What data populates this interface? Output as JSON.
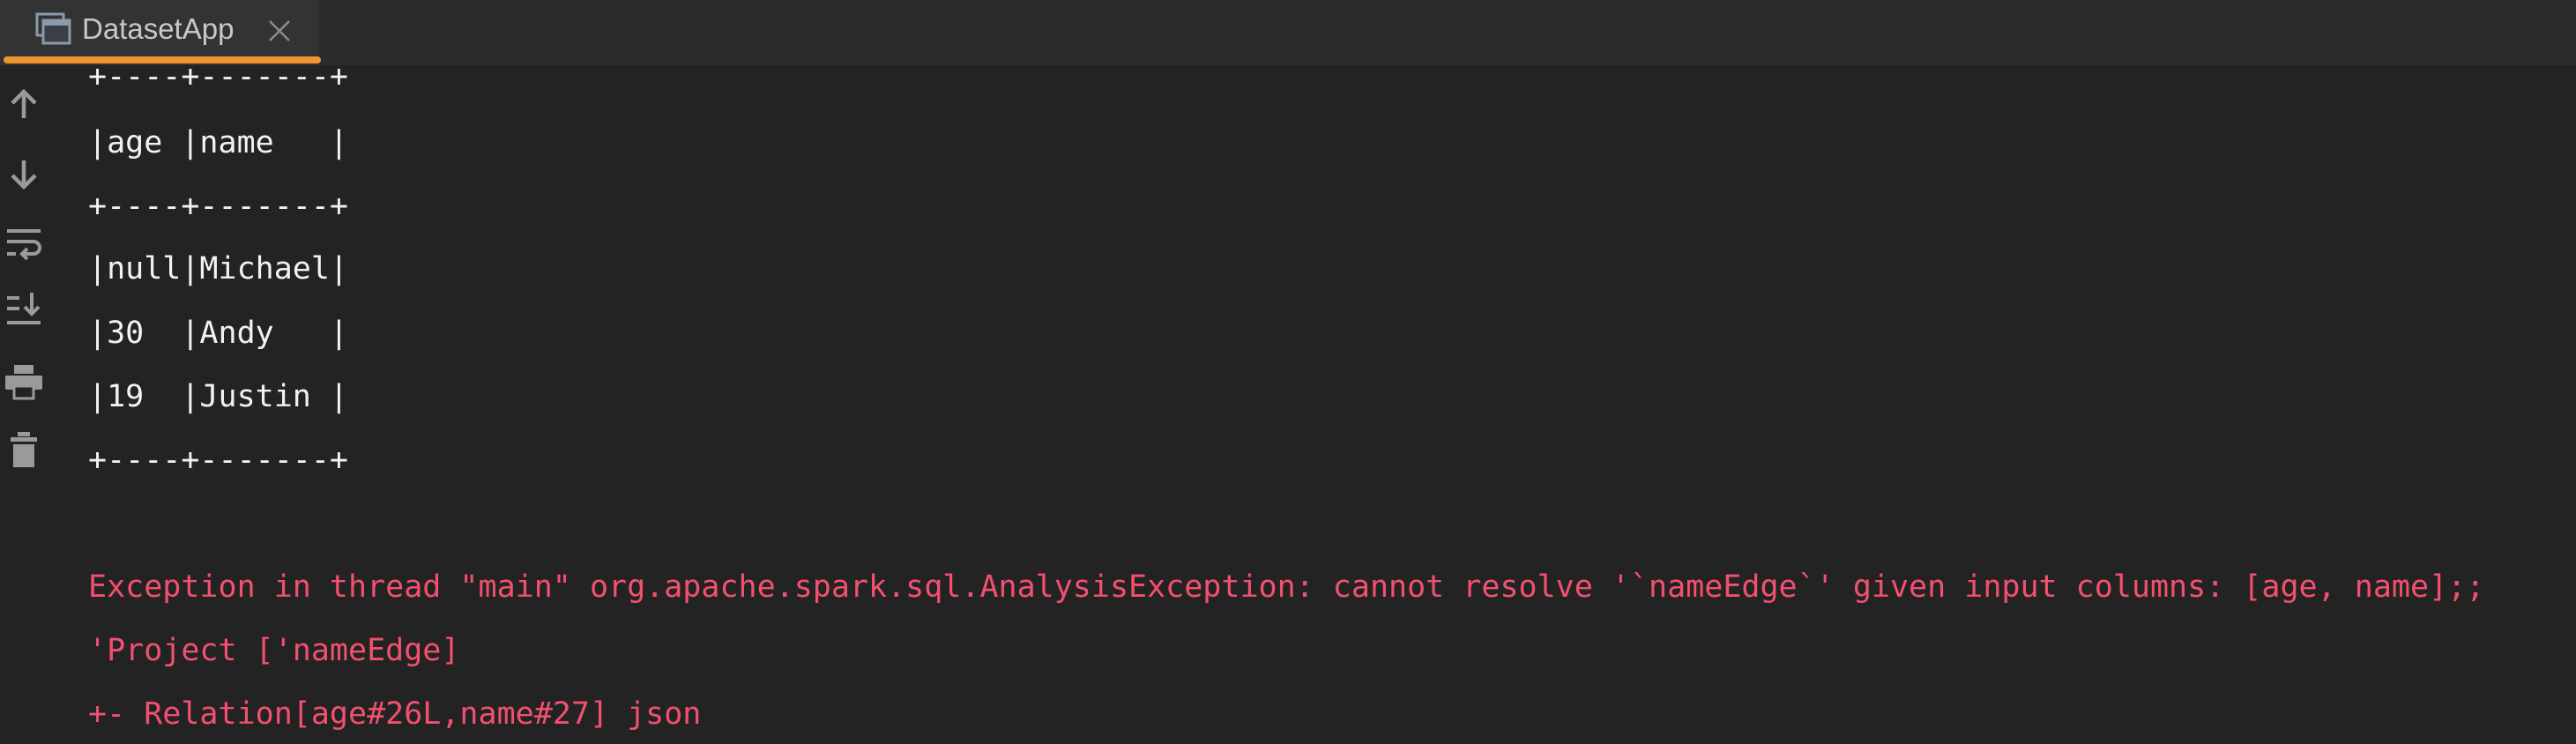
{
  "tab": {
    "title": "DatasetApp",
    "icon": "window-stack-icon",
    "close_icon": "close-icon",
    "accent_color": "#f0952f"
  },
  "toolbar": {
    "items": [
      {
        "icon": "arrow-up-icon",
        "label": "Up"
      },
      {
        "icon": "arrow-down-icon",
        "label": "Down"
      },
      {
        "icon": "soft-wrap-icon",
        "label": "Soft wrap"
      },
      {
        "icon": "scroll-to-end-icon",
        "label": "Scroll to end"
      },
      {
        "icon": "print-icon",
        "label": "Print"
      },
      {
        "icon": "trash-icon",
        "label": "Clear"
      }
    ]
  },
  "console": {
    "output_color": "#f2f2f2",
    "error_color": "#f2506e",
    "lines": [
      {
        "text": "+----+-------+",
        "type": "output"
      },
      {
        "text": "|age |name   |",
        "type": "output"
      },
      {
        "text": "+----+-------+",
        "type": "output"
      },
      {
        "text": "|null|Michael|",
        "type": "output"
      },
      {
        "text": "|30  |Andy   |",
        "type": "output"
      },
      {
        "text": "|19  |Justin |",
        "type": "output"
      },
      {
        "text": "+----+-------+",
        "type": "output"
      },
      {
        "text": "",
        "type": "output"
      },
      {
        "text": "Exception in thread \"main\" org.apache.spark.sql.AnalysisException: cannot resolve '`nameEdge`' given input columns: [age, name];;",
        "type": "error"
      },
      {
        "text": "'Project ['nameEdge]",
        "type": "error"
      },
      {
        "text": "+- Relation[age#26L,name#27] json",
        "type": "error"
      }
    ]
  }
}
